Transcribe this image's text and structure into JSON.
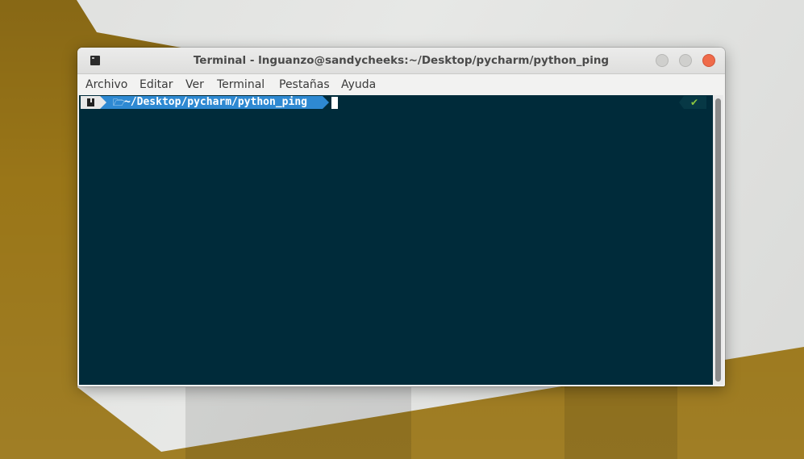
{
  "window": {
    "title": "Terminal - lnguanzo@sandycheeks:~/Desktop/pycharm/python_ping"
  },
  "menubar": {
    "items": [
      "Archivo",
      "Editar",
      "Ver",
      "Terminal",
      "Pestañas",
      "Ayuda"
    ]
  },
  "prompt": {
    "path": "~/Desktop/pycharm/python_ping",
    "status_symbol": "✔"
  },
  "icons": {
    "app": "terminal-icon",
    "host": "manjaro-logo-icon",
    "folder": "folder-open-icon",
    "status": "check-icon"
  },
  "colors": {
    "terminal_background": "#002b3a",
    "path_segment": "#2e89d2",
    "close_button": "#ef6b4a",
    "status_ok": "#8cc63f"
  }
}
